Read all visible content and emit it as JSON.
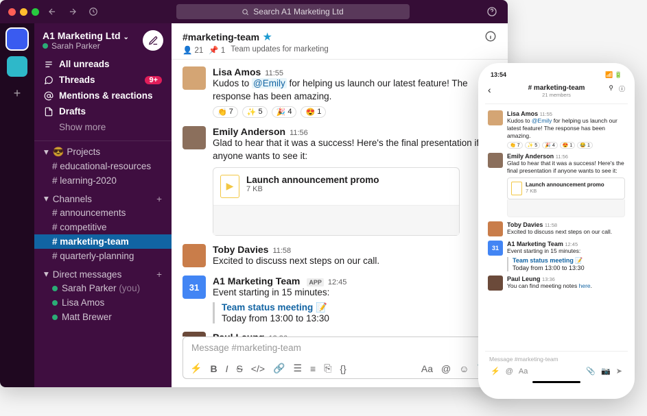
{
  "titlebar": {
    "search_placeholder": "Search A1 Marketing Ltd"
  },
  "workspace": {
    "name": "A1 Marketing Ltd",
    "user": "Sarah Parker"
  },
  "nav": {
    "unreads": "All unreads",
    "threads": "Threads",
    "threads_badge": "9+",
    "mentions": "Mentions & reactions",
    "drafts": "Drafts",
    "show_more": "Show more"
  },
  "sections": {
    "projects": {
      "label": "😎 Projects",
      "items": [
        "educational-resources",
        "learning-2020"
      ]
    },
    "channels": {
      "label": "Channels",
      "items": [
        "announcements",
        "competitive",
        "marketing-team",
        "quarterly-planning"
      ],
      "active": "marketing-team"
    },
    "dms": {
      "label": "Direct messages",
      "items": [
        {
          "name": "Sarah Parker",
          "you": "(you)"
        },
        {
          "name": "Lisa Amos"
        },
        {
          "name": "Matt Brewer"
        }
      ]
    }
  },
  "channel": {
    "name": "#marketing-team",
    "members": "21",
    "pins": "1",
    "topic": "Team updates for marketing"
  },
  "messages": [
    {
      "user": "Lisa Amos",
      "time": "11:55",
      "prefix": "Kudos to ",
      "mention": "@Emily",
      "rest": " for helping us launch our latest feature! The response has been amazing.",
      "reactions": [
        {
          "e": "👏",
          "c": "7"
        },
        {
          "e": "✨",
          "c": "5"
        },
        {
          "e": "🎉",
          "c": "4"
        },
        {
          "e": "😍",
          "c": "1"
        }
      ]
    },
    {
      "user": "Emily Anderson",
      "time": "11:56",
      "text": "Glad to hear that it was a success! Here's the final presentation if anyone wants to see it:",
      "file": {
        "title": "Launch announcement promo",
        "size": "7 KB"
      }
    },
    {
      "user": "Toby Davies",
      "time": "11:58",
      "text": "Excited to discuss next steps on our call."
    },
    {
      "user": "A1 Marketing Team",
      "app": "APP",
      "time": "12:45",
      "text": "Event starting in 15 minutes:",
      "event": {
        "title": "Team status meeting 📝",
        "when": "Today from 13:00 to 13:30"
      }
    },
    {
      "user": "Paul Leung",
      "time": "13:36",
      "prefix2": "You can find meeting notes ",
      "link": "here",
      "suffix": "."
    }
  ],
  "composer": {
    "placeholder": "Message #marketing-team"
  },
  "phone": {
    "clock": "13:54",
    "channel": "# marketing-team",
    "members": "21 members",
    "composer_placeholder": "Message #marketing-team",
    "cal_icon": "31"
  },
  "cal_day": "31"
}
